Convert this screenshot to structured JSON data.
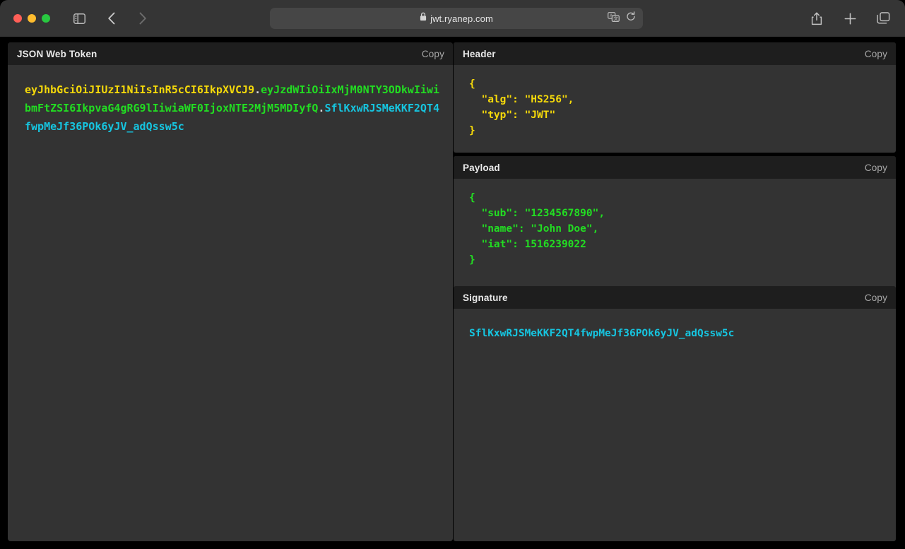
{
  "browser": {
    "window_controls": [
      "close",
      "minimize",
      "maximize"
    ],
    "sidebar_icon": "sidebar-toggle-icon",
    "back_icon": "chevron-left-icon",
    "forward_icon": "chevron-right-icon",
    "address": {
      "lock_icon": "lock-icon",
      "url": "jwt.ryanep.com",
      "translate_icon": "translate-icon",
      "reload_icon": "reload-icon"
    },
    "share_icon": "share-icon",
    "new_tab_icon": "plus-icon",
    "tabs_icon": "tab-overview-icon"
  },
  "jwt": {
    "panel_title": "JSON Web Token",
    "copy_label": "Copy",
    "header_b64": "eyJhbGciOiJIUzI1NiIsInR5cCI6IkpXVCJ9",
    "payload_b64": "eyJzdWIiOiIxMjM0NTY3ODkwIiwibmFtZSI6IkpvaG4gRG9lIiwiaWF0IjoxNTE2MjM5MDIyfQ",
    "signature_b64": "SflKxwRJSMeKKF2QT4fwpMeJf36POk6yJV_adQssw5c",
    "separator": "."
  },
  "panels": {
    "header": {
      "title": "Header",
      "copy_label": "Copy",
      "json": "{\n  \"alg\": \"HS256\",\n  \"typ\": \"JWT\"\n}"
    },
    "payload": {
      "title": "Payload",
      "copy_label": "Copy",
      "json": "{\n  \"sub\": \"1234567890\",\n  \"name\": \"John Doe\",\n  \"iat\": 1516239022\n}"
    },
    "signature": {
      "title": "Signature",
      "copy_label": "Copy",
      "value": "SflKxwRJSMeKKF2QT4fwpMeJf36POk6yJV_adQssw5c"
    }
  },
  "colors": {
    "header_token": "#f5d90a",
    "payload_token": "#22dd22",
    "signature_token": "#16c5e0",
    "chrome_bg": "#353535",
    "panel_bg": "#333333",
    "panel_head_bg": "#1e1e1e"
  }
}
